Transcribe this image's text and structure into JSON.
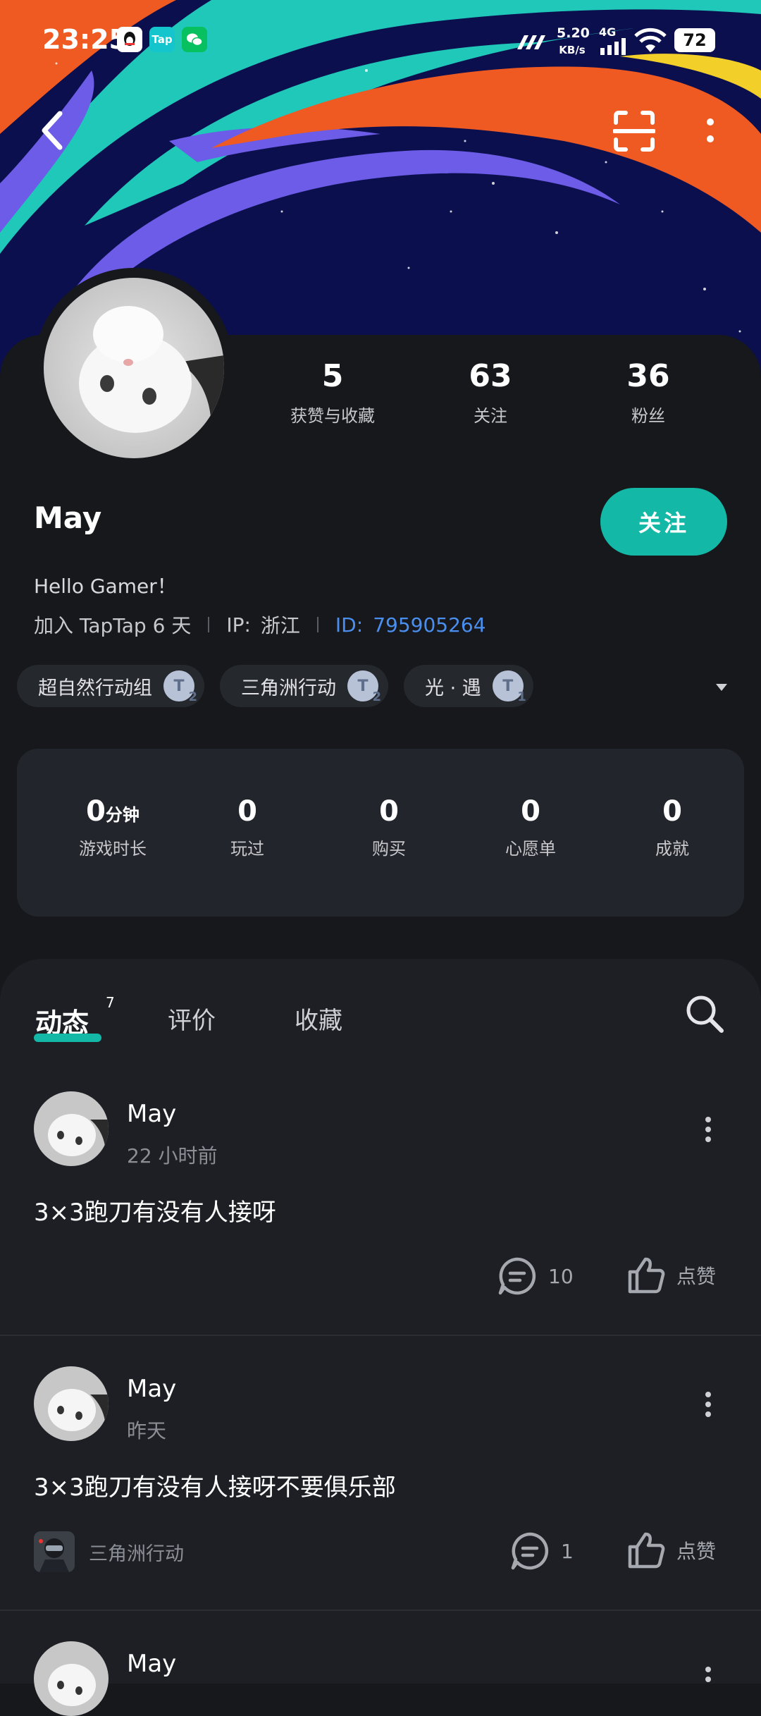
{
  "status_bar": {
    "time": "23:25",
    "net_speed_value": "5.20",
    "net_speed_unit": "KB/s",
    "network": "4G",
    "battery": "72",
    "apps": [
      "qq-icon",
      "taptap-icon",
      "wechat-icon"
    ]
  },
  "nav": {
    "back": "back-icon",
    "scan": "scan-icon",
    "more": "more-vertical-icon"
  },
  "profile": {
    "name": "May",
    "follow_label": "关注",
    "bio": "Hello Gamer！",
    "joined": "加入 TapTap 6 天",
    "ip_label": "IP:",
    "ip_value": "浙江",
    "id_label": "ID:",
    "id_value": "795905264",
    "stats": [
      {
        "value": "5",
        "label": "获赞与收藏"
      },
      {
        "value": "63",
        "label": "关注"
      },
      {
        "value": "36",
        "label": "粉丝"
      }
    ]
  },
  "tags": [
    {
      "label": "超自然行动组",
      "level": "2"
    },
    {
      "label": "三角洲行动",
      "level": "2"
    },
    {
      "label": "光 · 遇",
      "level": "1"
    }
  ],
  "game_stats": [
    {
      "value": "0",
      "unit": "分钟",
      "label": "游戏时长"
    },
    {
      "value": "0",
      "unit": "",
      "label": "玩过"
    },
    {
      "value": "0",
      "unit": "",
      "label": "购买"
    },
    {
      "value": "0",
      "unit": "",
      "label": "心愿单"
    },
    {
      "value": "0",
      "unit": "",
      "label": "成就"
    }
  ],
  "tabs": [
    {
      "label": "动态",
      "count": "7"
    },
    {
      "label": "评价"
    },
    {
      "label": "收藏"
    }
  ],
  "posts": [
    {
      "author": "May",
      "time": "22 小时前",
      "text": "3×3跑刀有没有人接呀",
      "comments": "10",
      "like_label": "点赞",
      "game": ""
    },
    {
      "author": "May",
      "time": "昨天",
      "text": "3×3跑刀有没有人接呀不要俱乐部",
      "comments": "1",
      "like_label": "点赞",
      "game": "三角洲行动"
    },
    {
      "author": "May"
    }
  ],
  "colors": {
    "accent": "#13b8a6",
    "id_link": "#4a8ff0",
    "background": "#16181b",
    "feed_bg": "#1d1f25"
  }
}
